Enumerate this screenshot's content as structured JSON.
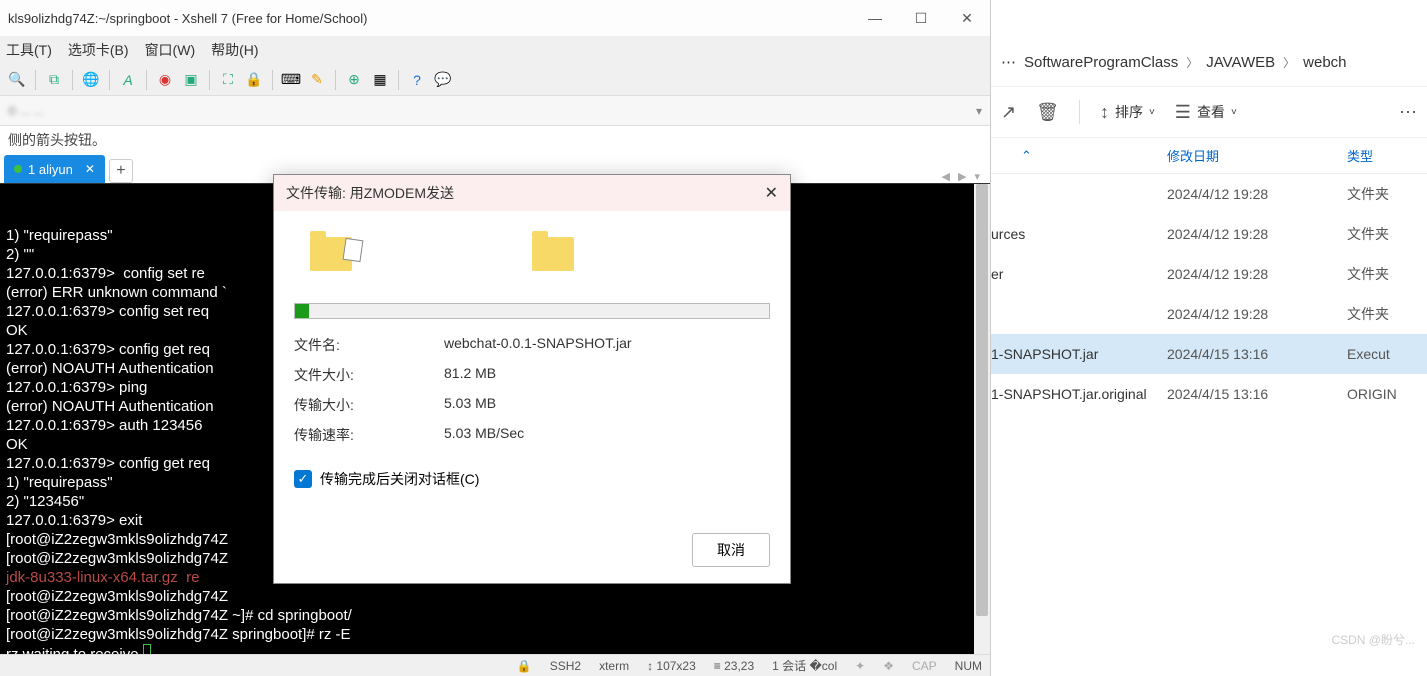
{
  "window": {
    "title": "kls9olizhdg74Z:~/springboot - Xshell 7 (Free for Home/School)"
  },
  "menubar": [
    "工具(T)",
    "选项卡(B)",
    "窗口(W)",
    "帮助(H)"
  ],
  "addressbar": "© ... ...",
  "hint": "侧的箭头按钮。",
  "tab": {
    "label": "1 aliyun"
  },
  "terminal_lines": [
    "1) \"requirepass\"",
    "2) \"\"",
    "127.0.0.1:6379>  config set re",
    "(error) ERR unknown command `                                                  123456`,",
    "127.0.0.1:6379> config set req",
    "OK",
    "127.0.0.1:6379> config get req",
    "(error) NOAUTH Authentication ",
    "127.0.0.1:6379> ping",
    "(error) NOAUTH Authentication ",
    "127.0.0.1:6379> auth 123456",
    "OK",
    "127.0.0.1:6379> config get req",
    "1) \"requirepass\"",
    "2) \"123456\"",
    "127.0.0.1:6379> exit",
    "[root@iZ2zegw3mkls9olizhdg74Z ",
    "[root@iZ2zegw3mkls9olizhdg74Z ",
    "jdk-8u333-linux-x64.tar.gz  re",
    "[root@iZ2zegw3mkls9olizhdg74Z ",
    "[root@iZ2zegw3mkls9olizhdg74Z ~]# cd springboot/",
    "[root@iZ2zegw3mkls9olizhdg74Z springboot]# rz -E",
    "rz waiting to receive."
  ],
  "statusbar": {
    "ssh": "SSH2",
    "term": "xterm",
    "size": "107x23",
    "pos": "23,23",
    "session": "1 会话",
    "cap": "CAP",
    "num": "NUM"
  },
  "dialog": {
    "title": "文件传输: 用ZMODEM发送",
    "rows": {
      "filename_label": "文件名:",
      "filename_value": "webchat-0.0.1-SNAPSHOT.jar",
      "filesize_label": "文件大小:",
      "filesize_value": "81.2 MB",
      "transize_label": "传输大小:",
      "transize_value": "5.03 MB",
      "speed_label": "传输速率:",
      "speed_value": "5.03 MB/Sec"
    },
    "checkbox_label": "传输完成后关闭对话框(C)",
    "cancel": "取消"
  },
  "breadcrumb": [
    "SoftwareProgramClass",
    "JAVAWEB",
    "webch"
  ],
  "explorer_toolbar": {
    "sort": "排序",
    "view": "查看"
  },
  "columns": {
    "date": "修改日期",
    "type": "类型"
  },
  "files": [
    {
      "name": "",
      "date": "2024/4/12 19:28",
      "type": "文件夹"
    },
    {
      "name": "urces",
      "date": "2024/4/12 19:28",
      "type": "文件夹"
    },
    {
      "name": "er",
      "date": "2024/4/12 19:28",
      "type": "文件夹"
    },
    {
      "name": "",
      "date": "2024/4/12 19:28",
      "type": "文件夹"
    },
    {
      "name": "1-SNAPSHOT.jar",
      "date": "2024/4/15 13:16",
      "type": "Execut",
      "selected": true
    },
    {
      "name": "1-SNAPSHOT.jar.original",
      "date": "2024/4/15 13:16",
      "type": "ORIGIN"
    }
  ],
  "watermark": "CSDN @盼兮..."
}
